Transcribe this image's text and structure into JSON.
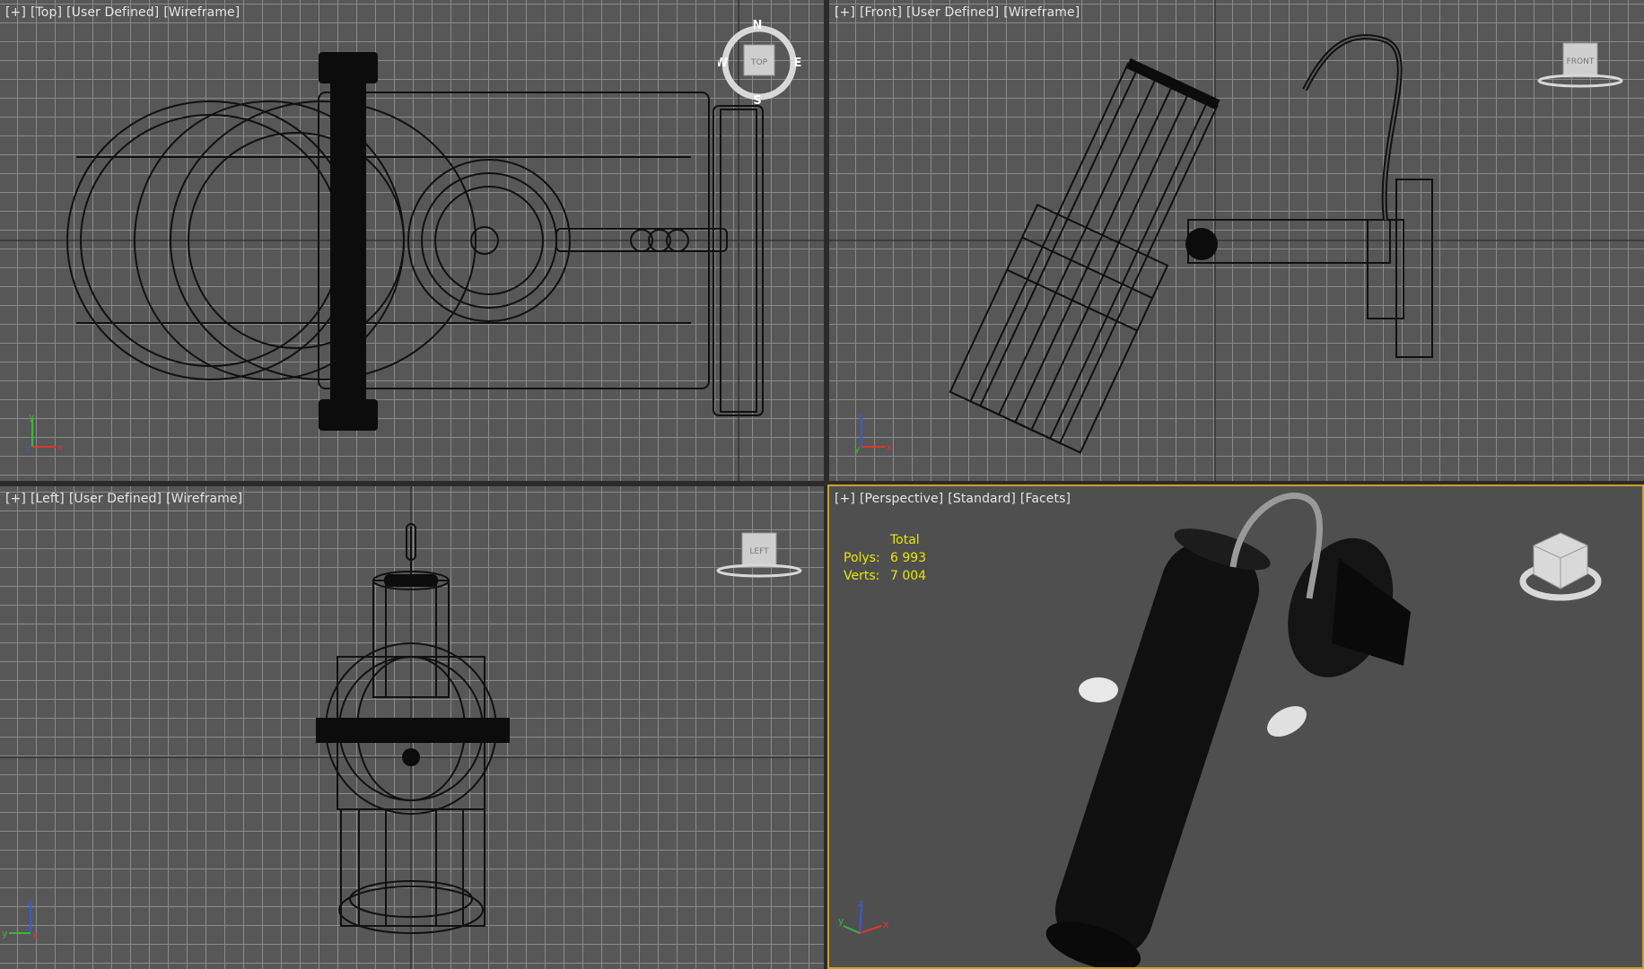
{
  "viewports": {
    "top": {
      "plus": "[+]",
      "view": "[Top]",
      "style": "[User Defined]",
      "shade": "[Wireframe]"
    },
    "front": {
      "plus": "[+]",
      "view": "[Front]",
      "style": "[User Defined]",
      "shade": "[Wireframe]"
    },
    "left": {
      "plus": "[+]",
      "view": "[Left]",
      "style": "[User Defined]",
      "shade": "[Wireframe]"
    },
    "persp": {
      "plus": "[+]",
      "view": "[Perspective]",
      "style": "[Standard]",
      "shade": "[Facets]"
    }
  },
  "stats": {
    "header": "Total",
    "polys_label": "Polys:",
    "polys_value": "6 993",
    "verts_label": "Verts:",
    "verts_value": "7 004"
  },
  "navcube": {
    "top_face": "TOP",
    "front_face": "FRONT",
    "left_face": "LEFT",
    "compass_n": "N",
    "compass_s": "S",
    "compass_e": "E",
    "compass_w": "W"
  },
  "axes": {
    "x": "x",
    "y": "y",
    "z": "z"
  },
  "colors": {
    "active_border": "#c9a227",
    "stats_text": "#e8e600",
    "grid_line": "#8a8a8a",
    "viewport_bg": "#575757",
    "axis_x": "#d63a2f",
    "axis_y": "#3fb43f",
    "axis_z": "#3a5bd6"
  }
}
